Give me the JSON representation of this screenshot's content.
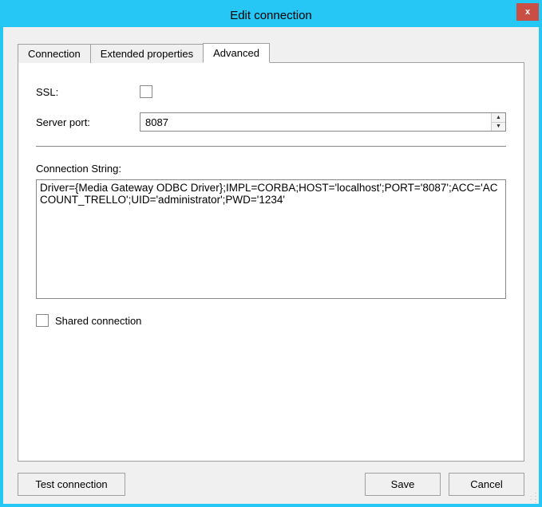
{
  "window": {
    "title": "Edit connection",
    "close_label": "x"
  },
  "tabs": {
    "connection": "Connection",
    "extended": "Extended properties",
    "advanced": "Advanced"
  },
  "form": {
    "ssl_label": "SSL:",
    "ssl_checked": false,
    "server_port_label": "Server port:",
    "server_port_value": "8087",
    "connection_string_label": "Connection String:",
    "connection_string_value": "Driver={Media Gateway ODBC Driver};IMPL=CORBA;HOST='localhost';PORT='8087';ACC='ACCOUNT_TRELLO';UID='administrator';PWD='1234'",
    "shared_label": "Shared connection",
    "shared_checked": false
  },
  "buttons": {
    "test": "Test connection",
    "save": "Save",
    "cancel": "Cancel"
  }
}
